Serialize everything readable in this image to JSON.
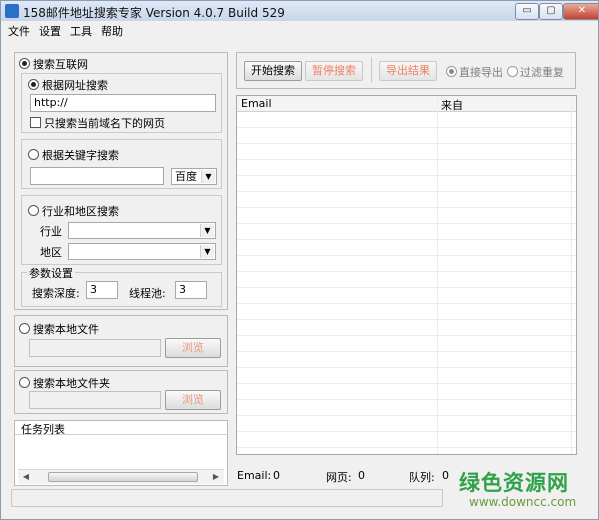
{
  "window": {
    "title": "158邮件地址搜索专家 Version 4.0.7 Build 529",
    "minimize_label": "▭",
    "maximize_label": "▢",
    "close_label": "✕"
  },
  "menu": [
    "文件",
    "设置",
    "工具",
    "帮助"
  ],
  "left": {
    "internet_search_label": "搜索互联网",
    "url_search_label": "根据网址搜索",
    "url_value": "http://",
    "domain_only_label": "只搜索当前域名下的网页",
    "keyword_search_label": "根据关键字搜索",
    "keyword_value": "",
    "engine_selected": "百度",
    "industry_search_label": "行业和地区搜索",
    "industry_label": "行业",
    "region_label": "地区",
    "params_label": "参数设置",
    "depth_label": "搜索深度:",
    "depth_value": "3",
    "threads_label": "线程池:",
    "threads_value": "3",
    "local_file_label": "搜索本地文件",
    "local_folder_label": "搜索本地文件夹",
    "browse_label": "浏览",
    "task_list_label": "任务列表"
  },
  "toolbar": {
    "start_label": "开始搜索",
    "pause_label": "暂停搜索",
    "export_label": "导出结果",
    "direct_export_label": "直接导出",
    "filter_dup_label": "过滤重复"
  },
  "table": {
    "columns": [
      "Email",
      "来自"
    ]
  },
  "status": {
    "email_label": "Email:",
    "email_count": "0",
    "pages_label": "网页:",
    "pages_count": "0",
    "queue_label": "队列:",
    "queue_count": "0"
  },
  "watermark": {
    "name": "绿色资源网",
    "url": "www.downcc.com"
  },
  "colors": {
    "disabled_button_text": "#f08060",
    "watermark_green": "#2fa24a"
  }
}
